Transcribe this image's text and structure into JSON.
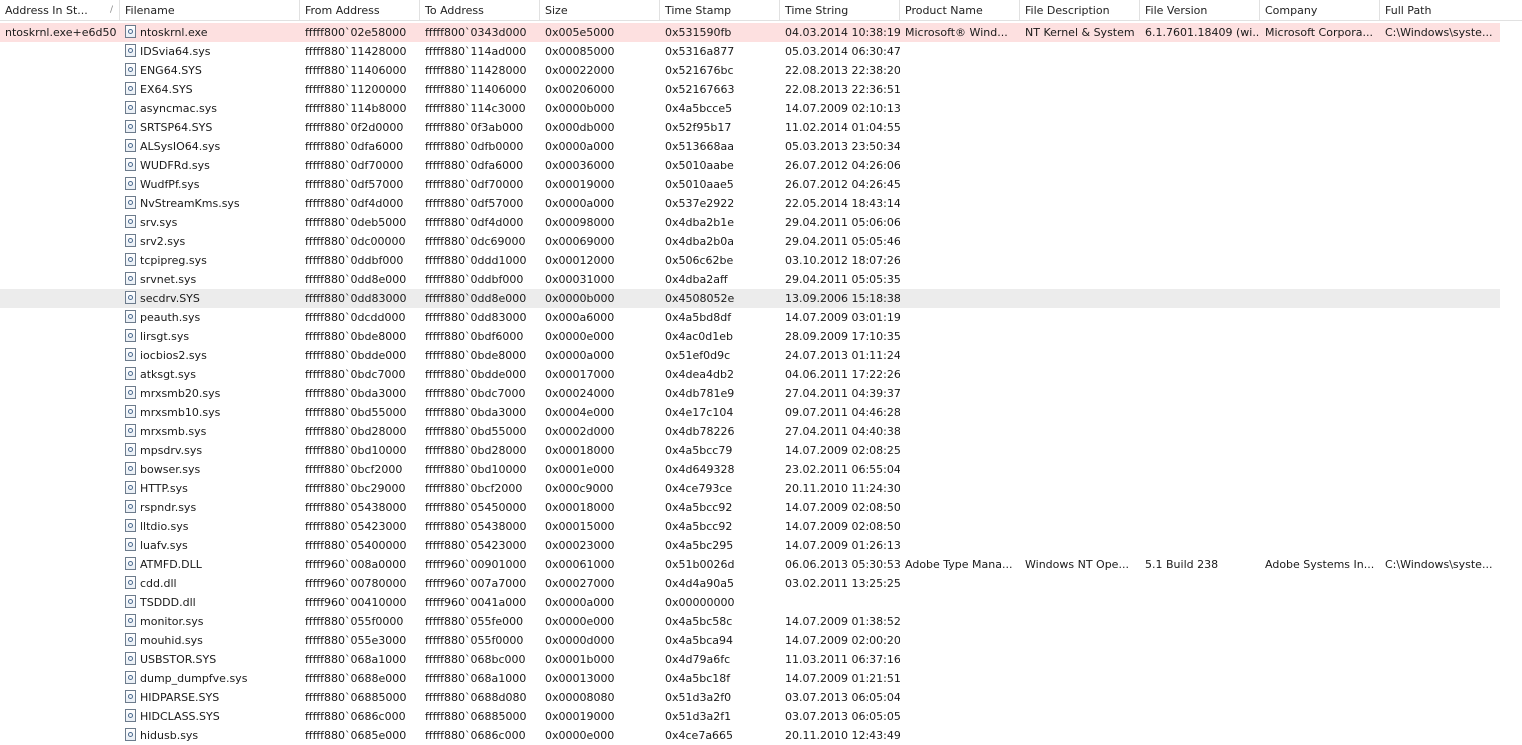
{
  "columns": [
    {
      "key": "addr_stack",
      "label": "Address In St..."
    },
    {
      "key": "filename",
      "label": "Filename"
    },
    {
      "key": "from",
      "label": "From Address"
    },
    {
      "key": "to",
      "label": "To Address"
    },
    {
      "key": "size",
      "label": "Size"
    },
    {
      "key": "stamp",
      "label": "Time Stamp"
    },
    {
      "key": "tstr",
      "label": "Time String"
    },
    {
      "key": "product",
      "label": "Product Name"
    },
    {
      "key": "desc",
      "label": "File Description"
    },
    {
      "key": "ver",
      "label": "File Version"
    },
    {
      "key": "company",
      "label": "Company"
    },
    {
      "key": "path",
      "label": "Full Path"
    }
  ],
  "sort_indicator": "/",
  "colors": {
    "highlight_red": "#fde0e0",
    "highlight_gray": "#ececec"
  },
  "rows": [
    {
      "addr_stack": "ntoskrnl.exe+e6d50",
      "filename": "ntoskrnl.exe",
      "from": "fffff800`02e58000",
      "to": "fffff800`0343d000",
      "size": "0x005e5000",
      "stamp": "0x531590fb",
      "tstr": "04.03.2014 10:38:19",
      "product": "Microsoft® Wind...",
      "desc": "NT Kernel & System",
      "ver": "6.1.7601.18409 (wi...",
      "company": "Microsoft Corpora...",
      "path": "C:\\Windows\\syste...",
      "highlight": "red"
    },
    {
      "filename": "IDSvia64.sys",
      "from": "fffff880`11428000",
      "to": "fffff880`114ad000",
      "size": "0x00085000",
      "stamp": "0x5316a877",
      "tstr": "05.03.2014 06:30:47"
    },
    {
      "filename": "ENG64.SYS",
      "from": "fffff880`11406000",
      "to": "fffff880`11428000",
      "size": "0x00022000",
      "stamp": "0x521676bc",
      "tstr": "22.08.2013 22:38:20"
    },
    {
      "filename": "EX64.SYS",
      "from": "fffff880`11200000",
      "to": "fffff880`11406000",
      "size": "0x00206000",
      "stamp": "0x52167663",
      "tstr": "22.08.2013 22:36:51"
    },
    {
      "filename": "asyncmac.sys",
      "from": "fffff880`114b8000",
      "to": "fffff880`114c3000",
      "size": "0x0000b000",
      "stamp": "0x4a5bcce5",
      "tstr": "14.07.2009 02:10:13"
    },
    {
      "filename": "SRTSP64.SYS",
      "from": "fffff880`0f2d0000",
      "to": "fffff880`0f3ab000",
      "size": "0x000db000",
      "stamp": "0x52f95b17",
      "tstr": "11.02.2014 01:04:55"
    },
    {
      "filename": "ALSysIO64.sys",
      "from": "fffff880`0dfa6000",
      "to": "fffff880`0dfb0000",
      "size": "0x0000a000",
      "stamp": "0x513668aa",
      "tstr": "05.03.2013 23:50:34"
    },
    {
      "filename": "WUDFRd.sys",
      "from": "fffff880`0df70000",
      "to": "fffff880`0dfa6000",
      "size": "0x00036000",
      "stamp": "0x5010aabe",
      "tstr": "26.07.2012 04:26:06"
    },
    {
      "filename": "WudfPf.sys",
      "from": "fffff880`0df57000",
      "to": "fffff880`0df70000",
      "size": "0x00019000",
      "stamp": "0x5010aae5",
      "tstr": "26.07.2012 04:26:45"
    },
    {
      "filename": "NvStreamKms.sys",
      "from": "fffff880`0df4d000",
      "to": "fffff880`0df57000",
      "size": "0x0000a000",
      "stamp": "0x537e2922",
      "tstr": "22.05.2014 18:43:14"
    },
    {
      "filename": "srv.sys",
      "from": "fffff880`0deb5000",
      "to": "fffff880`0df4d000",
      "size": "0x00098000",
      "stamp": "0x4dba2b1e",
      "tstr": "29.04.2011 05:06:06"
    },
    {
      "filename": "srv2.sys",
      "from": "fffff880`0dc00000",
      "to": "fffff880`0dc69000",
      "size": "0x00069000",
      "stamp": "0x4dba2b0a",
      "tstr": "29.04.2011 05:05:46"
    },
    {
      "filename": "tcpipreg.sys",
      "from": "fffff880`0ddbf000",
      "to": "fffff880`0ddd1000",
      "size": "0x00012000",
      "stamp": "0x506c62be",
      "tstr": "03.10.2012 18:07:26"
    },
    {
      "filename": "srvnet.sys",
      "from": "fffff880`0dd8e000",
      "to": "fffff880`0ddbf000",
      "size": "0x00031000",
      "stamp": "0x4dba2aff",
      "tstr": "29.04.2011 05:05:35"
    },
    {
      "filename": "secdrv.SYS",
      "from": "fffff880`0dd83000",
      "to": "fffff880`0dd8e000",
      "size": "0x0000b000",
      "stamp": "0x4508052e",
      "tstr": "13.09.2006 15:18:38",
      "highlight": "gray"
    },
    {
      "filename": "peauth.sys",
      "from": "fffff880`0dcdd000",
      "to": "fffff880`0dd83000",
      "size": "0x000a6000",
      "stamp": "0x4a5bd8df",
      "tstr": "14.07.2009 03:01:19"
    },
    {
      "filename": "lirsgt.sys",
      "from": "fffff880`0bde8000",
      "to": "fffff880`0bdf6000",
      "size": "0x0000e000",
      "stamp": "0x4ac0d1eb",
      "tstr": "28.09.2009 17:10:35"
    },
    {
      "filename": "iocbios2.sys",
      "from": "fffff880`0bdde000",
      "to": "fffff880`0bde8000",
      "size": "0x0000a000",
      "stamp": "0x51ef0d9c",
      "tstr": "24.07.2013 01:11:24"
    },
    {
      "filename": "atksgt.sys",
      "from": "fffff880`0bdc7000",
      "to": "fffff880`0bdde000",
      "size": "0x00017000",
      "stamp": "0x4dea4db2",
      "tstr": "04.06.2011 17:22:26"
    },
    {
      "filename": "mrxsmb20.sys",
      "from": "fffff880`0bda3000",
      "to": "fffff880`0bdc7000",
      "size": "0x00024000",
      "stamp": "0x4db781e9",
      "tstr": "27.04.2011 04:39:37"
    },
    {
      "filename": "mrxsmb10.sys",
      "from": "fffff880`0bd55000",
      "to": "fffff880`0bda3000",
      "size": "0x0004e000",
      "stamp": "0x4e17c104",
      "tstr": "09.07.2011 04:46:28"
    },
    {
      "filename": "mrxsmb.sys",
      "from": "fffff880`0bd28000",
      "to": "fffff880`0bd55000",
      "size": "0x0002d000",
      "stamp": "0x4db78226",
      "tstr": "27.04.2011 04:40:38"
    },
    {
      "filename": "mpsdrv.sys",
      "from": "fffff880`0bd10000",
      "to": "fffff880`0bd28000",
      "size": "0x00018000",
      "stamp": "0x4a5bcc79",
      "tstr": "14.07.2009 02:08:25"
    },
    {
      "filename": "bowser.sys",
      "from": "fffff880`0bcf2000",
      "to": "fffff880`0bd10000",
      "size": "0x0001e000",
      "stamp": "0x4d649328",
      "tstr": "23.02.2011 06:55:04"
    },
    {
      "filename": "HTTP.sys",
      "from": "fffff880`0bc29000",
      "to": "fffff880`0bcf2000",
      "size": "0x000c9000",
      "stamp": "0x4ce793ce",
      "tstr": "20.11.2010 11:24:30"
    },
    {
      "filename": "rspndr.sys",
      "from": "fffff880`05438000",
      "to": "fffff880`05450000",
      "size": "0x00018000",
      "stamp": "0x4a5bcc92",
      "tstr": "14.07.2009 02:08:50"
    },
    {
      "filename": "lltdio.sys",
      "from": "fffff880`05423000",
      "to": "fffff880`05438000",
      "size": "0x00015000",
      "stamp": "0x4a5bcc92",
      "tstr": "14.07.2009 02:08:50"
    },
    {
      "filename": "luafv.sys",
      "from": "fffff880`05400000",
      "to": "fffff880`05423000",
      "size": "0x00023000",
      "stamp": "0x4a5bc295",
      "tstr": "14.07.2009 01:26:13"
    },
    {
      "filename": "ATMFD.DLL",
      "from": "fffff960`008a0000",
      "to": "fffff960`00901000",
      "size": "0x00061000",
      "stamp": "0x51b0026d",
      "tstr": "06.06.2013 05:30:53",
      "product": "Adobe Type Mana...",
      "desc": "Windows NT Ope...",
      "ver": "5.1 Build 238",
      "company": "Adobe Systems In...",
      "path": "C:\\Windows\\syste..."
    },
    {
      "filename": "cdd.dll",
      "from": "fffff960`00780000",
      "to": "fffff960`007a7000",
      "size": "0x00027000",
      "stamp": "0x4d4a90a5",
      "tstr": "03.02.2011 13:25:25"
    },
    {
      "filename": "TSDDD.dll",
      "from": "fffff960`00410000",
      "to": "fffff960`0041a000",
      "size": "0x0000a000",
      "stamp": "0x00000000",
      "tstr": ""
    },
    {
      "filename": "monitor.sys",
      "from": "fffff880`055f0000",
      "to": "fffff880`055fe000",
      "size": "0x0000e000",
      "stamp": "0x4a5bc58c",
      "tstr": "14.07.2009 01:38:52"
    },
    {
      "filename": "mouhid.sys",
      "from": "fffff880`055e3000",
      "to": "fffff880`055f0000",
      "size": "0x0000d000",
      "stamp": "0x4a5bca94",
      "tstr": "14.07.2009 02:00:20"
    },
    {
      "filename": "USBSTOR.SYS",
      "from": "fffff880`068a1000",
      "to": "fffff880`068bc000",
      "size": "0x0001b000",
      "stamp": "0x4d79a6fc",
      "tstr": "11.03.2011 06:37:16"
    },
    {
      "filename": "dump_dumpfve.sys",
      "from": "fffff880`0688e000",
      "to": "fffff880`068a1000",
      "size": "0x00013000",
      "stamp": "0x4a5bc18f",
      "tstr": "14.07.2009 01:21:51"
    },
    {
      "filename": "HIDPARSE.SYS",
      "from": "fffff880`06885000",
      "to": "fffff880`0688d080",
      "size": "0x00008080",
      "stamp": "0x51d3a2f0",
      "tstr": "03.07.2013 06:05:04"
    },
    {
      "filename": "HIDCLASS.SYS",
      "from": "fffff880`0686c000",
      "to": "fffff880`06885000",
      "size": "0x00019000",
      "stamp": "0x51d3a2f1",
      "tstr": "03.07.2013 06:05:05"
    },
    {
      "filename": "hidusb.sys",
      "from": "fffff880`0685e000",
      "to": "fffff880`0686c000",
      "size": "0x0000e000",
      "stamp": "0x4ce7a665",
      "tstr": "20.11.2010 12:43:49"
    }
  ]
}
